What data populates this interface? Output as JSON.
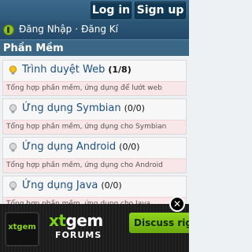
{
  "topbar": {
    "login_label": "Log in",
    "signup_label": "Sign up"
  },
  "auth": {
    "login_link": "Đăng Nhập",
    "separator": "·",
    "register_link": "Đăng Kí"
  },
  "section": {
    "title": "Phần Mềm"
  },
  "items": [
    {
      "name": "Trình duyệt Web",
      "count": "(1/8)",
      "desc": "Tổng hợp phần mềm, ứng dụng để lướt web",
      "active": true
    },
    {
      "name": "Ứng dụng Symbian",
      "count": "(0/0)",
      "desc": "Tổng hợp phần mềm, ứng dụng cho Symbian",
      "active": false
    },
    {
      "name": "Ứng dụng Android",
      "count": "(0/0)",
      "desc": "Tổng hợp phần mềm, ứng dụng cho Android",
      "active": false
    },
    {
      "name": "Ứng dụng Java",
      "count": "(0/0)",
      "desc": "Tổng hợp phần mềm, ứng dụng cho Java",
      "active": false
    }
  ],
  "ad": {
    "logo_text": "xtgem",
    "brand_prefix": "xt",
    "brand_suffix": "gem",
    "sub": "FORUMS",
    "cta": "Discuss right",
    "close": "✕"
  },
  "colors": {
    "accent": "#2f5a79",
    "bulb_on": "#f2c21b",
    "bulb_off": "#bdbdbd"
  }
}
